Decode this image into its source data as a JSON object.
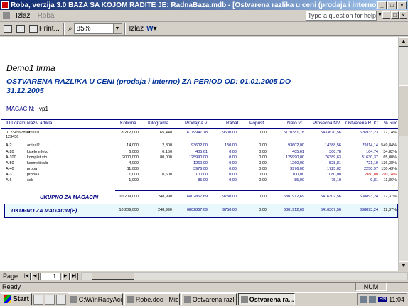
{
  "window": {
    "title": "Roba, verzija 3.0       BAZA SA KOJOM RADITE JE: RadnaBaza.mdb - [Ostvarena razlika u ceni (prodaja i interno)]"
  },
  "menu": {
    "items": [
      "Izlaz",
      "Roba"
    ],
    "help_placeholder": "Type a question for help"
  },
  "toolbar": {
    "print_label": "Print...",
    "zoom": "85%",
    "close_label": "Izlaz"
  },
  "report": {
    "firm": "Demo1 firma",
    "title": "OSTVARENA RAZLIKA U CENI (prodaja i interno) ZA PERIOD OD: 01.01.2005 DO 31.12.2005",
    "magacin_label": "MAGACIN:",
    "magacin_value": "vp1",
    "columns": [
      "ID Lokalni",
      "Naziv artikla",
      "Količina",
      "Kilograma",
      "Prodajna v.",
      "Rabat",
      "Popust",
      "Neto vr.",
      "Prosečna NV",
      "Ostvarena RUC",
      "% Ruc"
    ],
    "rows": [
      {
        "id": "01234567890 123456",
        "name": "artikal1",
        "kol": "8.212,000",
        "kg": "165,440",
        "prod": "6179941,78",
        "rab": "9600,00",
        "pop": "0,00",
        "neto": "6170381,78",
        "pnv": "5433670,56",
        "ruc": "626933,23",
        "pruc": "12,14%"
      },
      {
        "id": "A-2",
        "name": "artikal2",
        "kol": "14,000",
        "kg": "2,800",
        "prod": "93602,00",
        "rab": "150,00",
        "pop": "0,00",
        "neto": "93602,00",
        "pnv": "14388,56",
        "ruc": "79114,14",
        "pruc": "549,84%"
      },
      {
        "id": "A-20",
        "name": "kiselo mleko",
        "kol": "6,000",
        "kg": "0,150",
        "prod": "405,61",
        "rab": "0,00",
        "pop": "0,00",
        "neto": "405,61",
        "pnv": "300,78",
        "ruc": "104,74",
        "pruc": "34,82%"
      },
      {
        "id": "A-100",
        "name": "komplet sto",
        "kol": "2000,000",
        "kg": "80,000",
        "prod": "125990,00",
        "rab": "0,00",
        "pop": "0,00",
        "neto": "125990,00",
        "pnv": "76389,63",
        "ruc": "51630,37",
        "pruc": "65,00%"
      },
      {
        "id": "A-50",
        "name": "kosmetika b",
        "kol": "4,000",
        "kg": "",
        "prod": "1260,00",
        "rab": "0,00",
        "pop": "0,00",
        "neto": "1260,00",
        "pnv": "528,81",
        "ruc": "721,19",
        "pruc": "136,38%"
      },
      {
        "id": "A-40",
        "name": "proba",
        "kol": "11,000",
        "kg": "",
        "prod": "3976,00",
        "rab": "0,00",
        "pop": "0,00",
        "neto": "3976,00",
        "pnv": "1725,02",
        "ruc": "2250,97",
        "pruc": "130,43%"
      },
      {
        "id": "A-3",
        "name": "proba3",
        "kol": "1,000",
        "kg": "0,600",
        "prod": "100,00",
        "rab": "0,00",
        "pop": "0,00",
        "neto": "100,00",
        "pnv": "1080,00",
        "ruc": "-980,00",
        "pruc": "-90,74%"
      },
      {
        "id": "A-6",
        "name": "sok",
        "kol": "1,000",
        "kg": "",
        "prod": "85,00",
        "rab": "0,00",
        "pop": "0,00",
        "neto": "85,00",
        "pnv": "75,19",
        "ruc": "9,81",
        "pruc": "11,86%"
      }
    ],
    "total_magacin": {
      "label": "UKUPNO ZA MAGACIN",
      "kol": "10.209,000",
      "kg": "248,990",
      "prod": "6802867,69",
      "rab": "9750,00",
      "pop": "0,00",
      "neto": "6801912,69",
      "pnv": "5416307,56",
      "ruc": "638893,24",
      "pruc": "12,37%"
    },
    "total_magacine": {
      "label": "UKUPNO ZA MAGACIN(E)",
      "kol": "10.209,000",
      "kg": "248,990",
      "prod": "6802867,69",
      "rab": "9750,00",
      "pop": "0,00",
      "neto": "6801912,69",
      "pnv": "5416307,56",
      "ruc": "638893,24",
      "pruc": "12,37%"
    }
  },
  "nav": {
    "page_label": "Page:",
    "page": "1"
  },
  "status": {
    "ready": "Ready",
    "num": "NUM"
  },
  "taskbar": {
    "start": "Start",
    "tasks": [
      "C:\\WinRadyAcc...",
      "Robe.doc - Mic...",
      "Ostvarena razl...",
      "Ostvarena ra..."
    ],
    "time": "11:04",
    "lang": "EN"
  },
  "colors": {
    "report_title": "#003399",
    "header": "#000080",
    "negative": "#cc0000",
    "titlebar": "#0a246a"
  }
}
